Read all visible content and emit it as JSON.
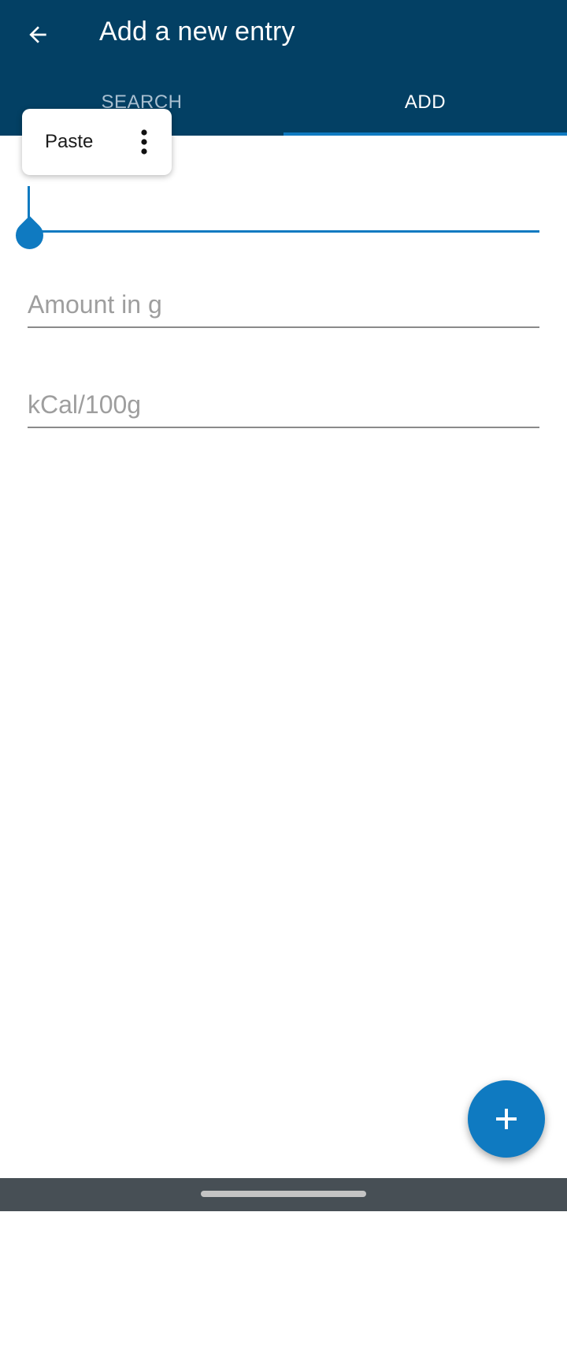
{
  "app_bar": {
    "title": "Add a new entry",
    "back_icon": "arrow-back-icon"
  },
  "tabs": [
    {
      "label": "SEARCH",
      "selected": false
    },
    {
      "label": "ADD",
      "selected": true
    }
  ],
  "form": {
    "name_field": {
      "value": "",
      "placeholder": ""
    },
    "amount_field": {
      "value": "",
      "placeholder": "Amount in g"
    },
    "kcal_field": {
      "value": "",
      "placeholder": "kCal/100g"
    }
  },
  "context_menu": {
    "paste_label": "Paste",
    "more_icon": "more-vertical-icon"
  },
  "fab": {
    "icon": "plus-icon"
  },
  "colors": {
    "primary_dark": "#034064",
    "accent": "#0f7ac1",
    "nav_bar": "#474f55"
  }
}
